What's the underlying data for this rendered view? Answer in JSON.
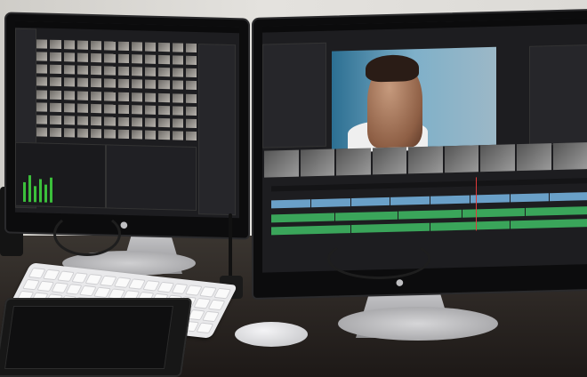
{
  "scene": {
    "description_free": true,
    "left_monitor": {
      "menu_text": "",
      "panels": [
        "media-pool-thumbnails",
        "audio-mixer"
      ]
    },
    "right_monitor": {
      "menu_text": "",
      "panels": [
        "viewer",
        "clip-strip",
        "timeline"
      ]
    },
    "brand_mark": ""
  },
  "colors": {
    "video_track": "#6aa0c8",
    "audio_track": "#3aa55a",
    "playhead": "#e03a3a",
    "meter": "#3bbf3b"
  }
}
